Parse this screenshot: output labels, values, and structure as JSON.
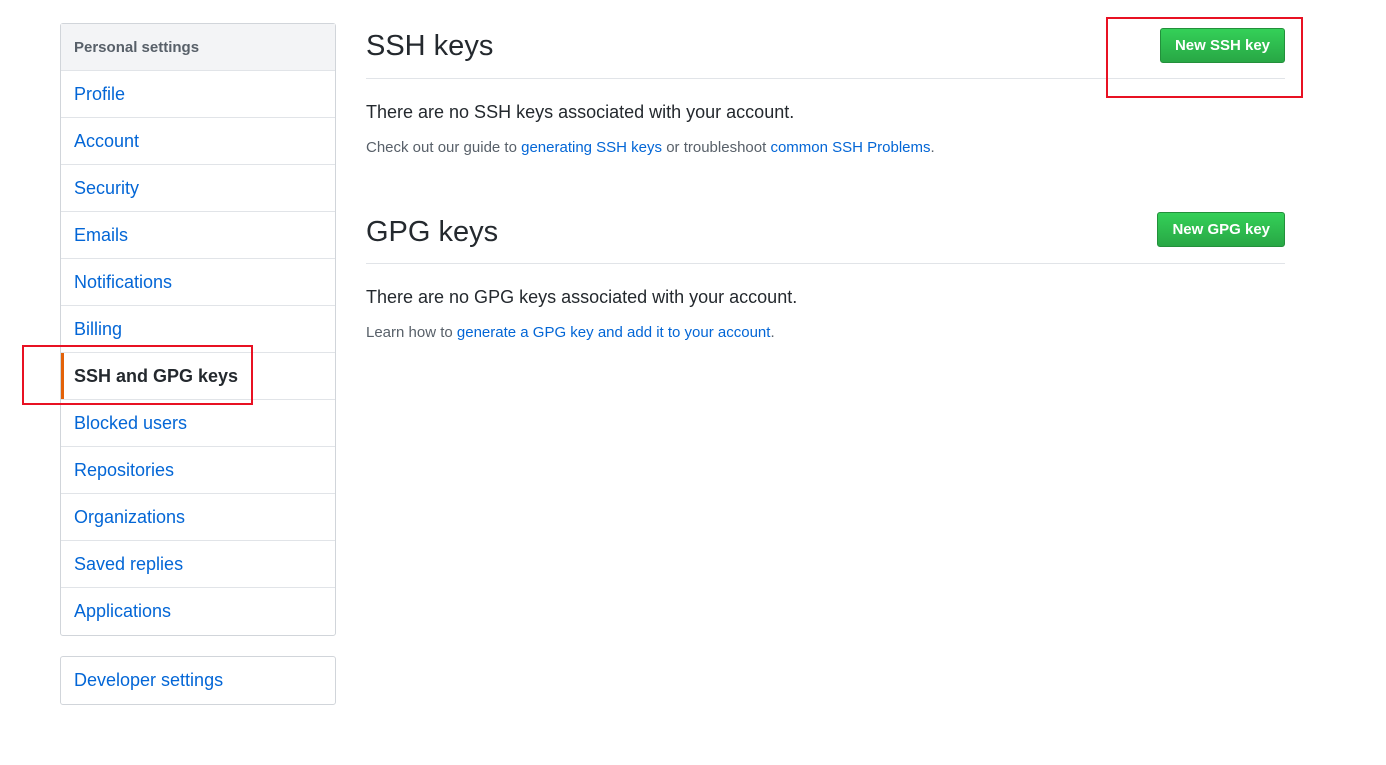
{
  "sidebar": {
    "heading": "Personal settings",
    "items": [
      {
        "label": "Profile"
      },
      {
        "label": "Account"
      },
      {
        "label": "Security"
      },
      {
        "label": "Emails"
      },
      {
        "label": "Notifications"
      },
      {
        "label": "Billing"
      },
      {
        "label": "SSH and GPG keys",
        "selected": true
      },
      {
        "label": "Blocked users"
      },
      {
        "label": "Repositories"
      },
      {
        "label": "Organizations"
      },
      {
        "label": "Saved replies"
      },
      {
        "label": "Applications"
      }
    ],
    "developer_settings": "Developer settings"
  },
  "ssh": {
    "title": "SSH keys",
    "button": "New SSH key",
    "blank": "There are no SSH keys associated with your account.",
    "note_prefix": "Check out our guide to ",
    "note_link1": "generating SSH keys",
    "note_middle": " or troubleshoot ",
    "note_link2": "common SSH Problems",
    "note_suffix": "."
  },
  "gpg": {
    "title": "GPG keys",
    "button": "New GPG key",
    "blank": "There are no GPG keys associated with your account.",
    "note_prefix": "Learn how to ",
    "note_link": "generate a GPG key and add it to your account",
    "note_suffix": "."
  },
  "colors": {
    "link": "#0366d6",
    "button_green": "#28a745",
    "selected_bar": "#e36209",
    "annotation_red": "#e81123"
  }
}
